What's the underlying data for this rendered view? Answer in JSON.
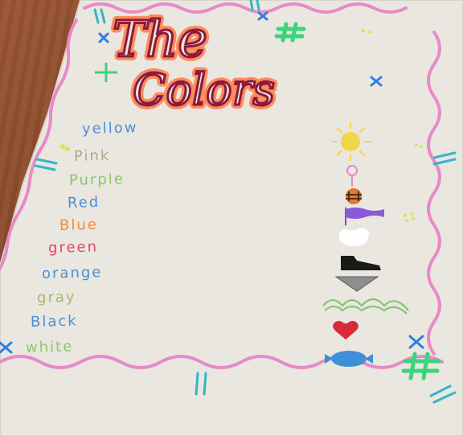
{
  "poster": {
    "title_line1": "The",
    "title_line2": "Colors",
    "words": [
      {
        "text": "yellow",
        "color": "#4a8fd6"
      },
      {
        "text": "Pink",
        "color": "#b8a58a"
      },
      {
        "text": "Purple",
        "color": "#8fc46a"
      },
      {
        "text": "Red",
        "color": "#4a8fd6"
      },
      {
        "text": "Blue",
        "color": "#f08a3c"
      },
      {
        "text": "green",
        "color": "#e0456a"
      },
      {
        "text": "orange",
        "color": "#4a8fd6"
      },
      {
        "text": "gray",
        "color": "#a7b86a"
      },
      {
        "text": "Black",
        "color": "#4a8fd6"
      },
      {
        "text": "white",
        "color": "#8fc46a"
      }
    ]
  },
  "colors": {
    "paper": "#e9e7e0",
    "border_pink": "#e889c8",
    "title_fill": "#8a1a3c",
    "title_outline": "#ff8a5c",
    "accent_green": "#3bd47a",
    "accent_blue": "#2f7fe0"
  }
}
